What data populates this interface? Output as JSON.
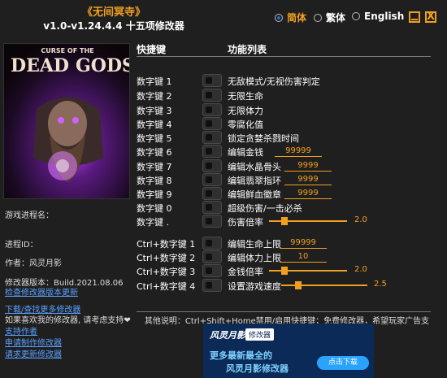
{
  "header": {
    "title": "《无间冥寺》",
    "version": "v1.0-v1.24.4.4 十五项修改器"
  },
  "languages": [
    {
      "label": "简体",
      "selected": true
    },
    {
      "label": "繁体",
      "selected": false
    },
    {
      "label": "English",
      "selected": false
    }
  ],
  "window_controls": {
    "close_glyph": "X"
  },
  "cover": {
    "logo_top": "CURSE OF THE",
    "logo_main_left": "DEAD",
    "logo_main_right": "GODS"
  },
  "left_panel": {
    "process_name_label": "游戏进程名：",
    "process_id_label": "进程ID：",
    "author": "作者：风灵月影",
    "build": "修改器版本：Build.2021.08.06",
    "check_version_link": "检查修改器版本更新",
    "download_more_link": "下载/查找更多修改器",
    "support_text": "如果喜欢我的修改器, 请考虑支持❤",
    "support_author_link": "支持作者",
    "request_link": "申请制作修改器",
    "request_update_link": "请求更新修改器"
  },
  "columns": {
    "hotkey": "快捷键",
    "function": "功能列表"
  },
  "rows": [
    {
      "key": "数字键 1",
      "func": "无敌模式/无视伤害判定"
    },
    {
      "key": "数字键 2",
      "func": "无限生命"
    },
    {
      "key": "数字键 3",
      "func": "无限体力"
    },
    {
      "key": "数字键 4",
      "func": "零腐化值"
    },
    {
      "key": "数字键 5",
      "func": "锁定贪婪杀戮时间"
    },
    {
      "key": "数字键 6",
      "func": "编辑金钱",
      "value": "99999"
    },
    {
      "key": "数字键 7",
      "func": "编辑水晶骨头",
      "value": "9999"
    },
    {
      "key": "数字键 8",
      "func": "编辑翡翠指环",
      "value": "9999"
    },
    {
      "key": "数字键 9",
      "func": "编辑鲜血徽章",
      "value": "9999"
    },
    {
      "key": "数字键 0",
      "func": "超级伤害/一击必杀"
    },
    {
      "key": "数字键 .",
      "func": "伤害倍率",
      "slider": "2.0",
      "level": 0.2
    },
    {
      "key": "Ctrl+数字键 1",
      "func": "编辑生命上限",
      "value": "99999"
    },
    {
      "key": "Ctrl+数字键 2",
      "func": "编辑体力上限",
      "value": "10"
    },
    {
      "key": "Ctrl+数字键 3",
      "func": "金钱倍率",
      "slider": "2.0",
      "level": 0.2
    },
    {
      "key": "Ctrl+数字键 4",
      "func": "设置游戏速度",
      "slider": "2.5",
      "level": 0.2
    }
  ],
  "footer_note": "其他说明：Ctrl+Shift+Home禁用/启用快捷键；免费修改器，希望玩家广告支持！",
  "ad": {
    "brand": "风灵月影",
    "tag": "修改器",
    "line1": "更多最新最全的",
    "line2": "风灵月影修改器",
    "button": "点击下载"
  },
  "colors": {
    "accent": "#f0a020",
    "background": "#1f1f1f",
    "link": "#5aa0ff"
  }
}
